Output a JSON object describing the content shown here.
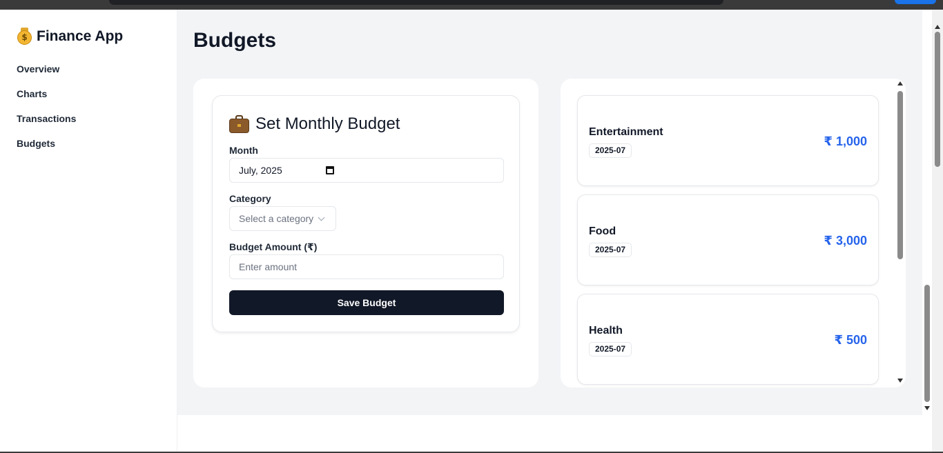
{
  "app": {
    "brand_title": "Finance App",
    "brand_icon": "money-bag-icon"
  },
  "nav": [
    {
      "label": "Overview"
    },
    {
      "label": "Charts"
    },
    {
      "label": "Transactions"
    },
    {
      "label": "Budgets"
    }
  ],
  "page": {
    "title": "Budgets"
  },
  "form": {
    "title": "Set Monthly Budget",
    "icon": "briefcase-icon",
    "month_label": "Month",
    "month_value": "July, 2025",
    "category_label": "Category",
    "category_placeholder": "Select a category",
    "amount_label": "Budget Amount (₹)",
    "amount_placeholder": "Enter amount",
    "submit_label": "Save Budget"
  },
  "budgets": [
    {
      "category": "Entertainment",
      "month": "2025-07",
      "amount": "₹ 1,000"
    },
    {
      "category": "Food",
      "month": "2025-07",
      "amount": "₹ 3,000"
    },
    {
      "category": "Health",
      "month": "2025-07",
      "amount": "₹ 500"
    }
  ],
  "colors": {
    "accent": "#2563eb",
    "button": "#111827",
    "background": "#f3f4f6"
  }
}
